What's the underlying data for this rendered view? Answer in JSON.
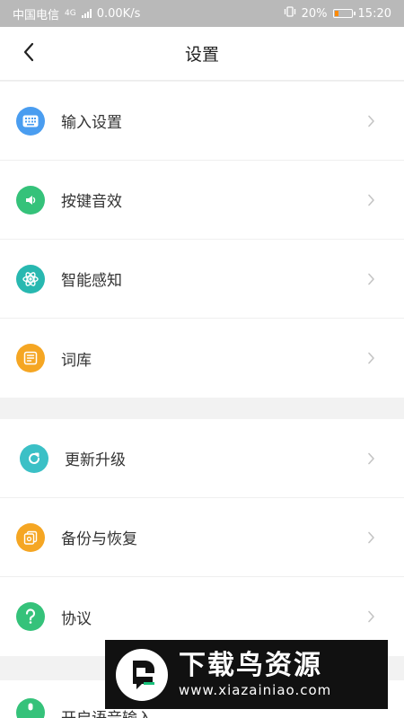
{
  "status_bar": {
    "carrier": "中国电信",
    "network": "4G",
    "speed": "0.00K/s",
    "battery": "20%",
    "time": "15:20",
    "battery_level": 0.2,
    "battery_color": "#ff8a00"
  },
  "header": {
    "title": "设置",
    "back_icon": "chevron-left-icon"
  },
  "groups": [
    {
      "items": [
        {
          "label": "输入设置",
          "icon": "keyboard-icon",
          "color": "#4a9df0"
        },
        {
          "label": "按键音效",
          "icon": "speaker-icon",
          "color": "#35c27a"
        },
        {
          "label": "智能感知",
          "icon": "atom-icon",
          "color": "#28b8b0"
        },
        {
          "label": "词库",
          "icon": "dictionary-icon",
          "color": "#f5a623"
        }
      ]
    },
    {
      "items": [
        {
          "label": "更新升级",
          "icon": "refresh-icon",
          "color": "#3bc0c6"
        },
        {
          "label": "备份与恢复",
          "icon": "backup-icon",
          "color": "#f5a623"
        },
        {
          "label": "协议",
          "icon": "question-icon",
          "color": "#35c27a"
        }
      ]
    }
  ],
  "partial_item": {
    "label": "开启语音输入",
    "icon": "microphone-icon",
    "color": "#35c27a"
  },
  "watermark": {
    "title": "下载鸟资源",
    "url": "www.xiazainiao.com"
  }
}
